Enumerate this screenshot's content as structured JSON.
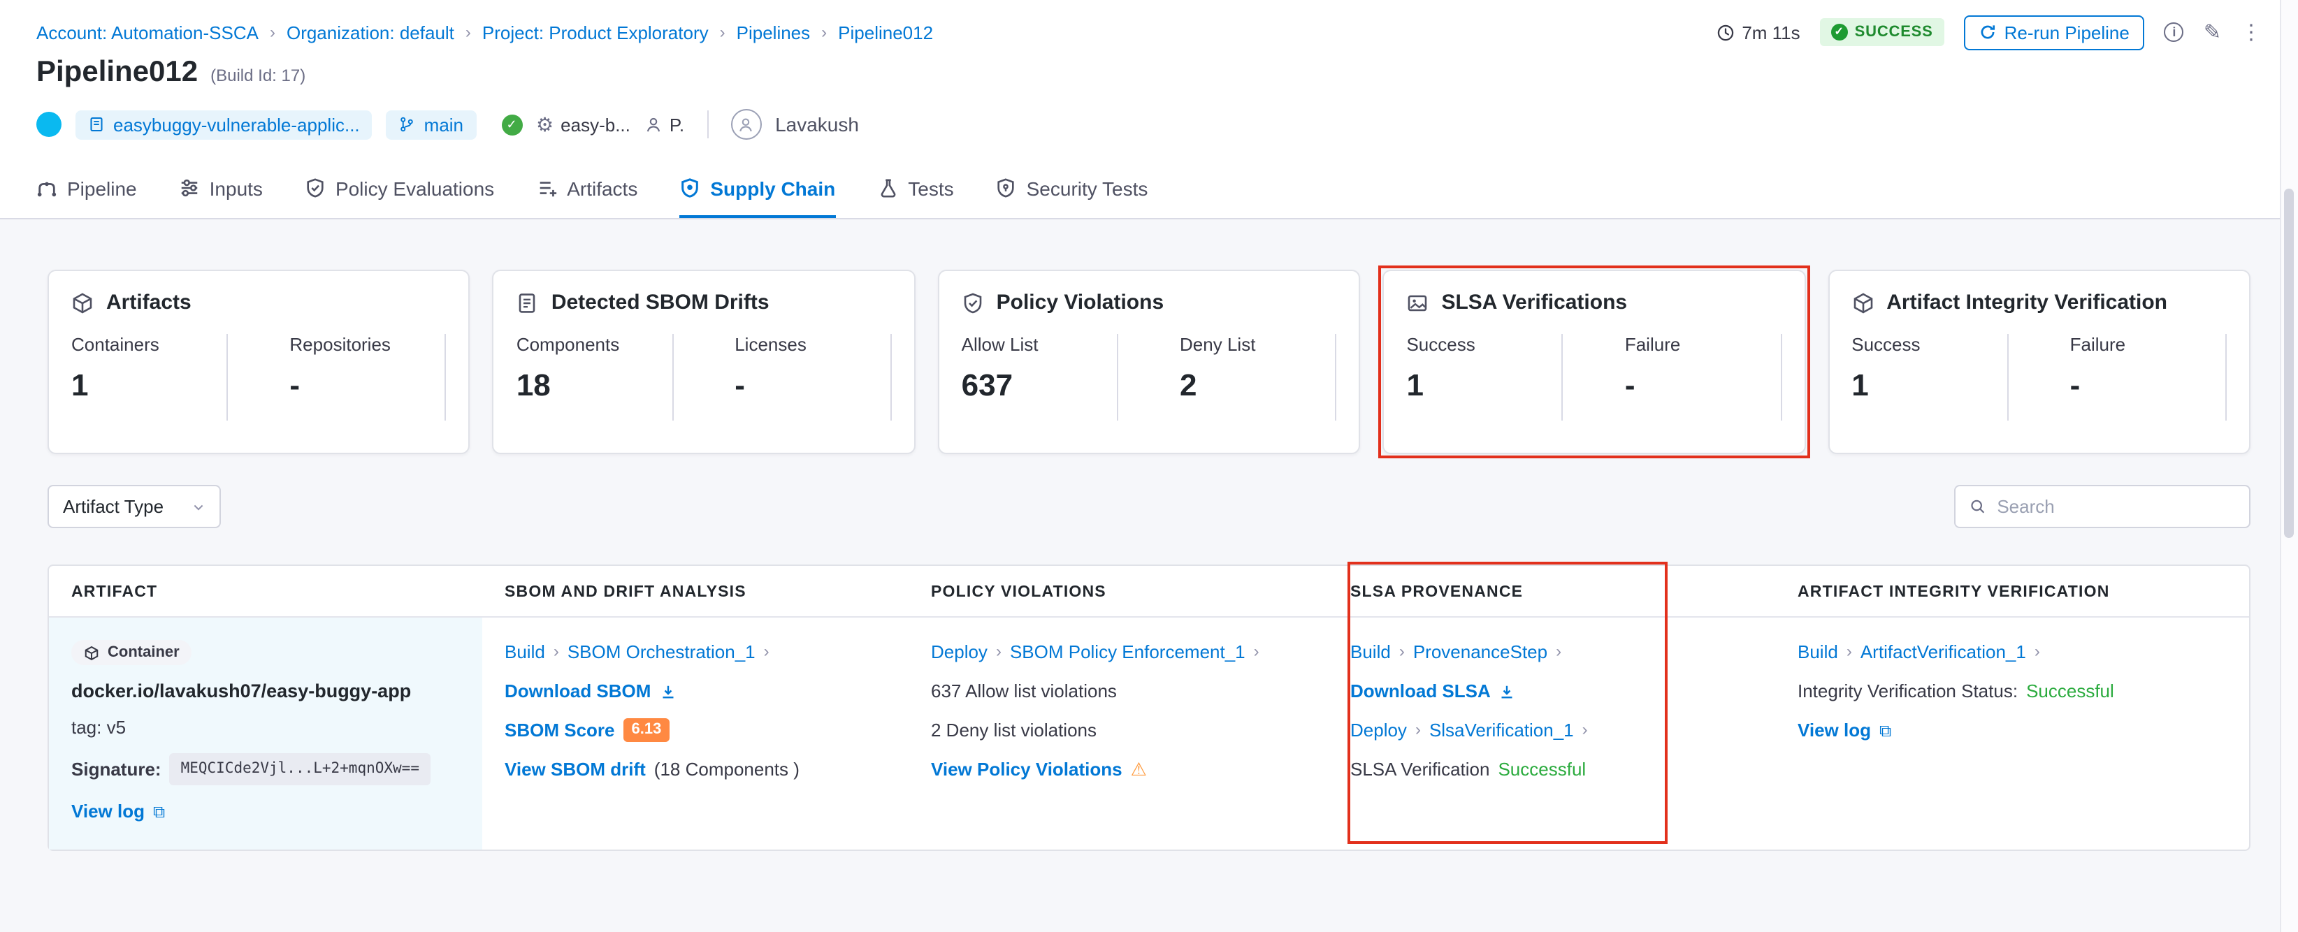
{
  "colors": {
    "accent_blue": "#0278d5",
    "success_green": "#1e8a2e",
    "success_text_green": "#2bab3e",
    "highlight_red": "#e2301c",
    "score_badge_orange": "#ff8942",
    "page_background": "#f6f7fa"
  },
  "icons": {
    "chevron_right": "›",
    "chevron_down": "⌄",
    "check": "✓",
    "gear": "⚙",
    "pencil": "✎",
    "kebab": "⋮",
    "info": "i",
    "warning": "⚠",
    "external": "⧉"
  },
  "breadcrumb": {
    "items": [
      "Account: Automation-SSCA",
      "Organization: default",
      "Project: Product Exploratory",
      "Pipelines",
      "Pipeline012"
    ]
  },
  "toolbar": {
    "duration": "7m 11s",
    "status_badge": "SUCCESS",
    "rerun_button": "Re-run Pipeline"
  },
  "header": {
    "title": "Pipeline012",
    "build_id": "(Build Id: 17)",
    "repo_name": "easybuggy-vulnerable-applic...",
    "branch": "main",
    "config_name": "easy-b...",
    "user_short": "P.",
    "user_name": "Lavakush"
  },
  "tabs": [
    {
      "label": "Pipeline"
    },
    {
      "label": "Inputs"
    },
    {
      "label": "Policy Evaluations"
    },
    {
      "label": "Artifacts"
    },
    {
      "label": "Supply Chain"
    },
    {
      "label": "Tests"
    },
    {
      "label": "Security Tests"
    }
  ],
  "summary_cards": [
    {
      "title": "Artifacts",
      "stats": [
        {
          "label": "Containers",
          "value": "1"
        },
        {
          "label": "Repositories",
          "value": "-"
        }
      ]
    },
    {
      "title": "Detected SBOM Drifts",
      "stats": [
        {
          "label": "Components",
          "value": "18"
        },
        {
          "label": "Licenses",
          "value": "-"
        }
      ]
    },
    {
      "title": "Policy Violations",
      "stats": [
        {
          "label": "Allow List",
          "value": "637"
        },
        {
          "label": "Deny List",
          "value": "2"
        }
      ]
    },
    {
      "title": "SLSA Verifications",
      "stats": [
        {
          "label": "Success",
          "value": "1"
        },
        {
          "label": "Failure",
          "value": "-"
        }
      ]
    },
    {
      "title": "Artifact Integrity Verification",
      "stats": [
        {
          "label": "Success",
          "value": "1"
        },
        {
          "label": "Failure",
          "value": "-"
        }
      ]
    }
  ],
  "filters": {
    "artifact_type_label": "Artifact Type",
    "search_placeholder": "Search"
  },
  "table": {
    "headers": [
      "ARTIFACT",
      "SBOM AND DRIFT ANALYSIS",
      "POLICY VIOLATIONS",
      "SLSA PROVENANCE",
      "ARTIFACT INTEGRITY VERIFICATION"
    ],
    "row": {
      "artifact": {
        "type_badge": "Container",
        "name": "docker.io/lavakush07/easy-buggy-app",
        "tag": "tag: v5",
        "signature_label": "Signature:",
        "signature_value": "MEQCICde2Vjl...L+2+mqnOXw==",
        "view_log_link": "View log"
      },
      "sbom": {
        "stage_link": "Build",
        "step_link": "SBOM Orchestration_1",
        "download_link": "Download SBOM",
        "score_link": "SBOM Score",
        "score_value": "6.13",
        "drift_link": "View SBOM drift",
        "drift_note": "(18 Components )"
      },
      "policy": {
        "stage_link": "Deploy",
        "step_link": "SBOM Policy Enforcement_1",
        "allow_text": "637 Allow list violations",
        "deny_text": "2 Deny list violations",
        "view_link": "View Policy Violations"
      },
      "slsa": {
        "stage1_link": "Build",
        "step1_link": "ProvenanceStep",
        "download_link": "Download SLSA",
        "stage2_link": "Deploy",
        "step2_link": "SlsaVerification_1",
        "status_prefix": "SLSA Verification",
        "status_value": "Successful"
      },
      "integrity": {
        "stage_link": "Build",
        "step_link": "ArtifactVerification_1",
        "status_prefix": "Integrity Verification Status:",
        "status_value": "Successful",
        "view_log_link": "View log"
      }
    }
  }
}
